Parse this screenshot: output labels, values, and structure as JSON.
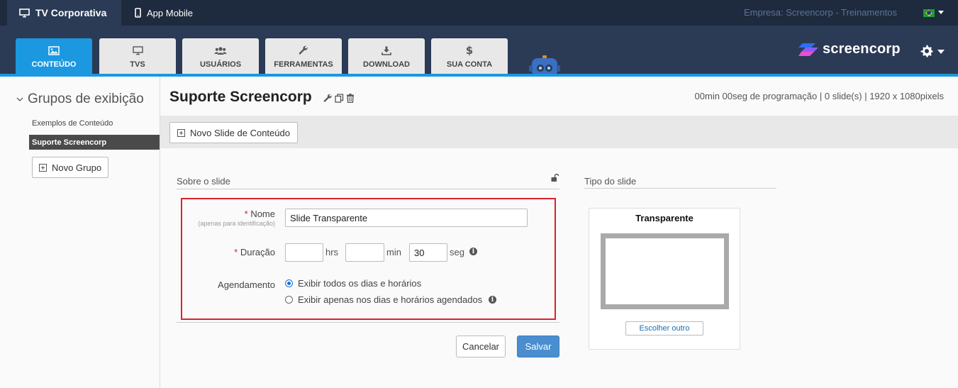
{
  "topbar": {
    "tabs": [
      {
        "label": "TV Corporativa",
        "active": true
      },
      {
        "label": "App Mobile",
        "active": false
      }
    ],
    "company": "Empresa: Screencorp - Treinamentos"
  },
  "nav": {
    "tabs": [
      {
        "label": "CONTEÚDO",
        "icon": "image-icon",
        "active": true
      },
      {
        "label": "TVS",
        "icon": "monitor-icon",
        "active": false
      },
      {
        "label": "USUÁRIOS",
        "icon": "users-icon",
        "active": false
      },
      {
        "label": "FERRAMENTAS",
        "icon": "wrench-icon",
        "active": false
      },
      {
        "label": "DOWNLOAD",
        "icon": "download-icon",
        "active": false
      },
      {
        "label": "SUA CONTA",
        "icon": "dollar-icon",
        "active": false
      }
    ],
    "logo_text": "screencorp",
    "accent_color": "#1b98e0"
  },
  "sidebar": {
    "title": "Grupos de exibição",
    "items": [
      {
        "label": "Exemplos de Conteúdo",
        "selected": false
      },
      {
        "label": "Suporte Screencorp",
        "selected": true
      }
    ],
    "new_group_label": "Novo Grupo"
  },
  "main": {
    "title": "Suporte Screencorp",
    "meta": "00min 00seg de programação | 0 slide(s) | 1920 x 1080pixels",
    "new_slide_label": "Novo Slide de Conteúdo",
    "about_section": "Sobre o slide",
    "type_section": "Tipo do slide",
    "form": {
      "name_required": "*",
      "name_label": "Nome",
      "name_hint": "(apenas para identificação)",
      "name_value": "Slide Transparente",
      "duration_required": "*",
      "duration_label": "Duração",
      "hours_value": "",
      "hours_unit": "hrs",
      "minutes_value": "",
      "minutes_unit": "min",
      "seconds_value": "30",
      "seconds_unit": "seg",
      "schedule_label": "Agendamento",
      "schedule_options": [
        {
          "label": "Exibir todos os dias e horários",
          "checked": true
        },
        {
          "label": "Exibir apenas nos dias e horários agendados",
          "checked": false
        }
      ]
    },
    "cancel_label": "Cancelar",
    "save_label": "Salvar",
    "slide_type": {
      "name": "Transparente",
      "choose_label": "Escolher outro"
    }
  }
}
